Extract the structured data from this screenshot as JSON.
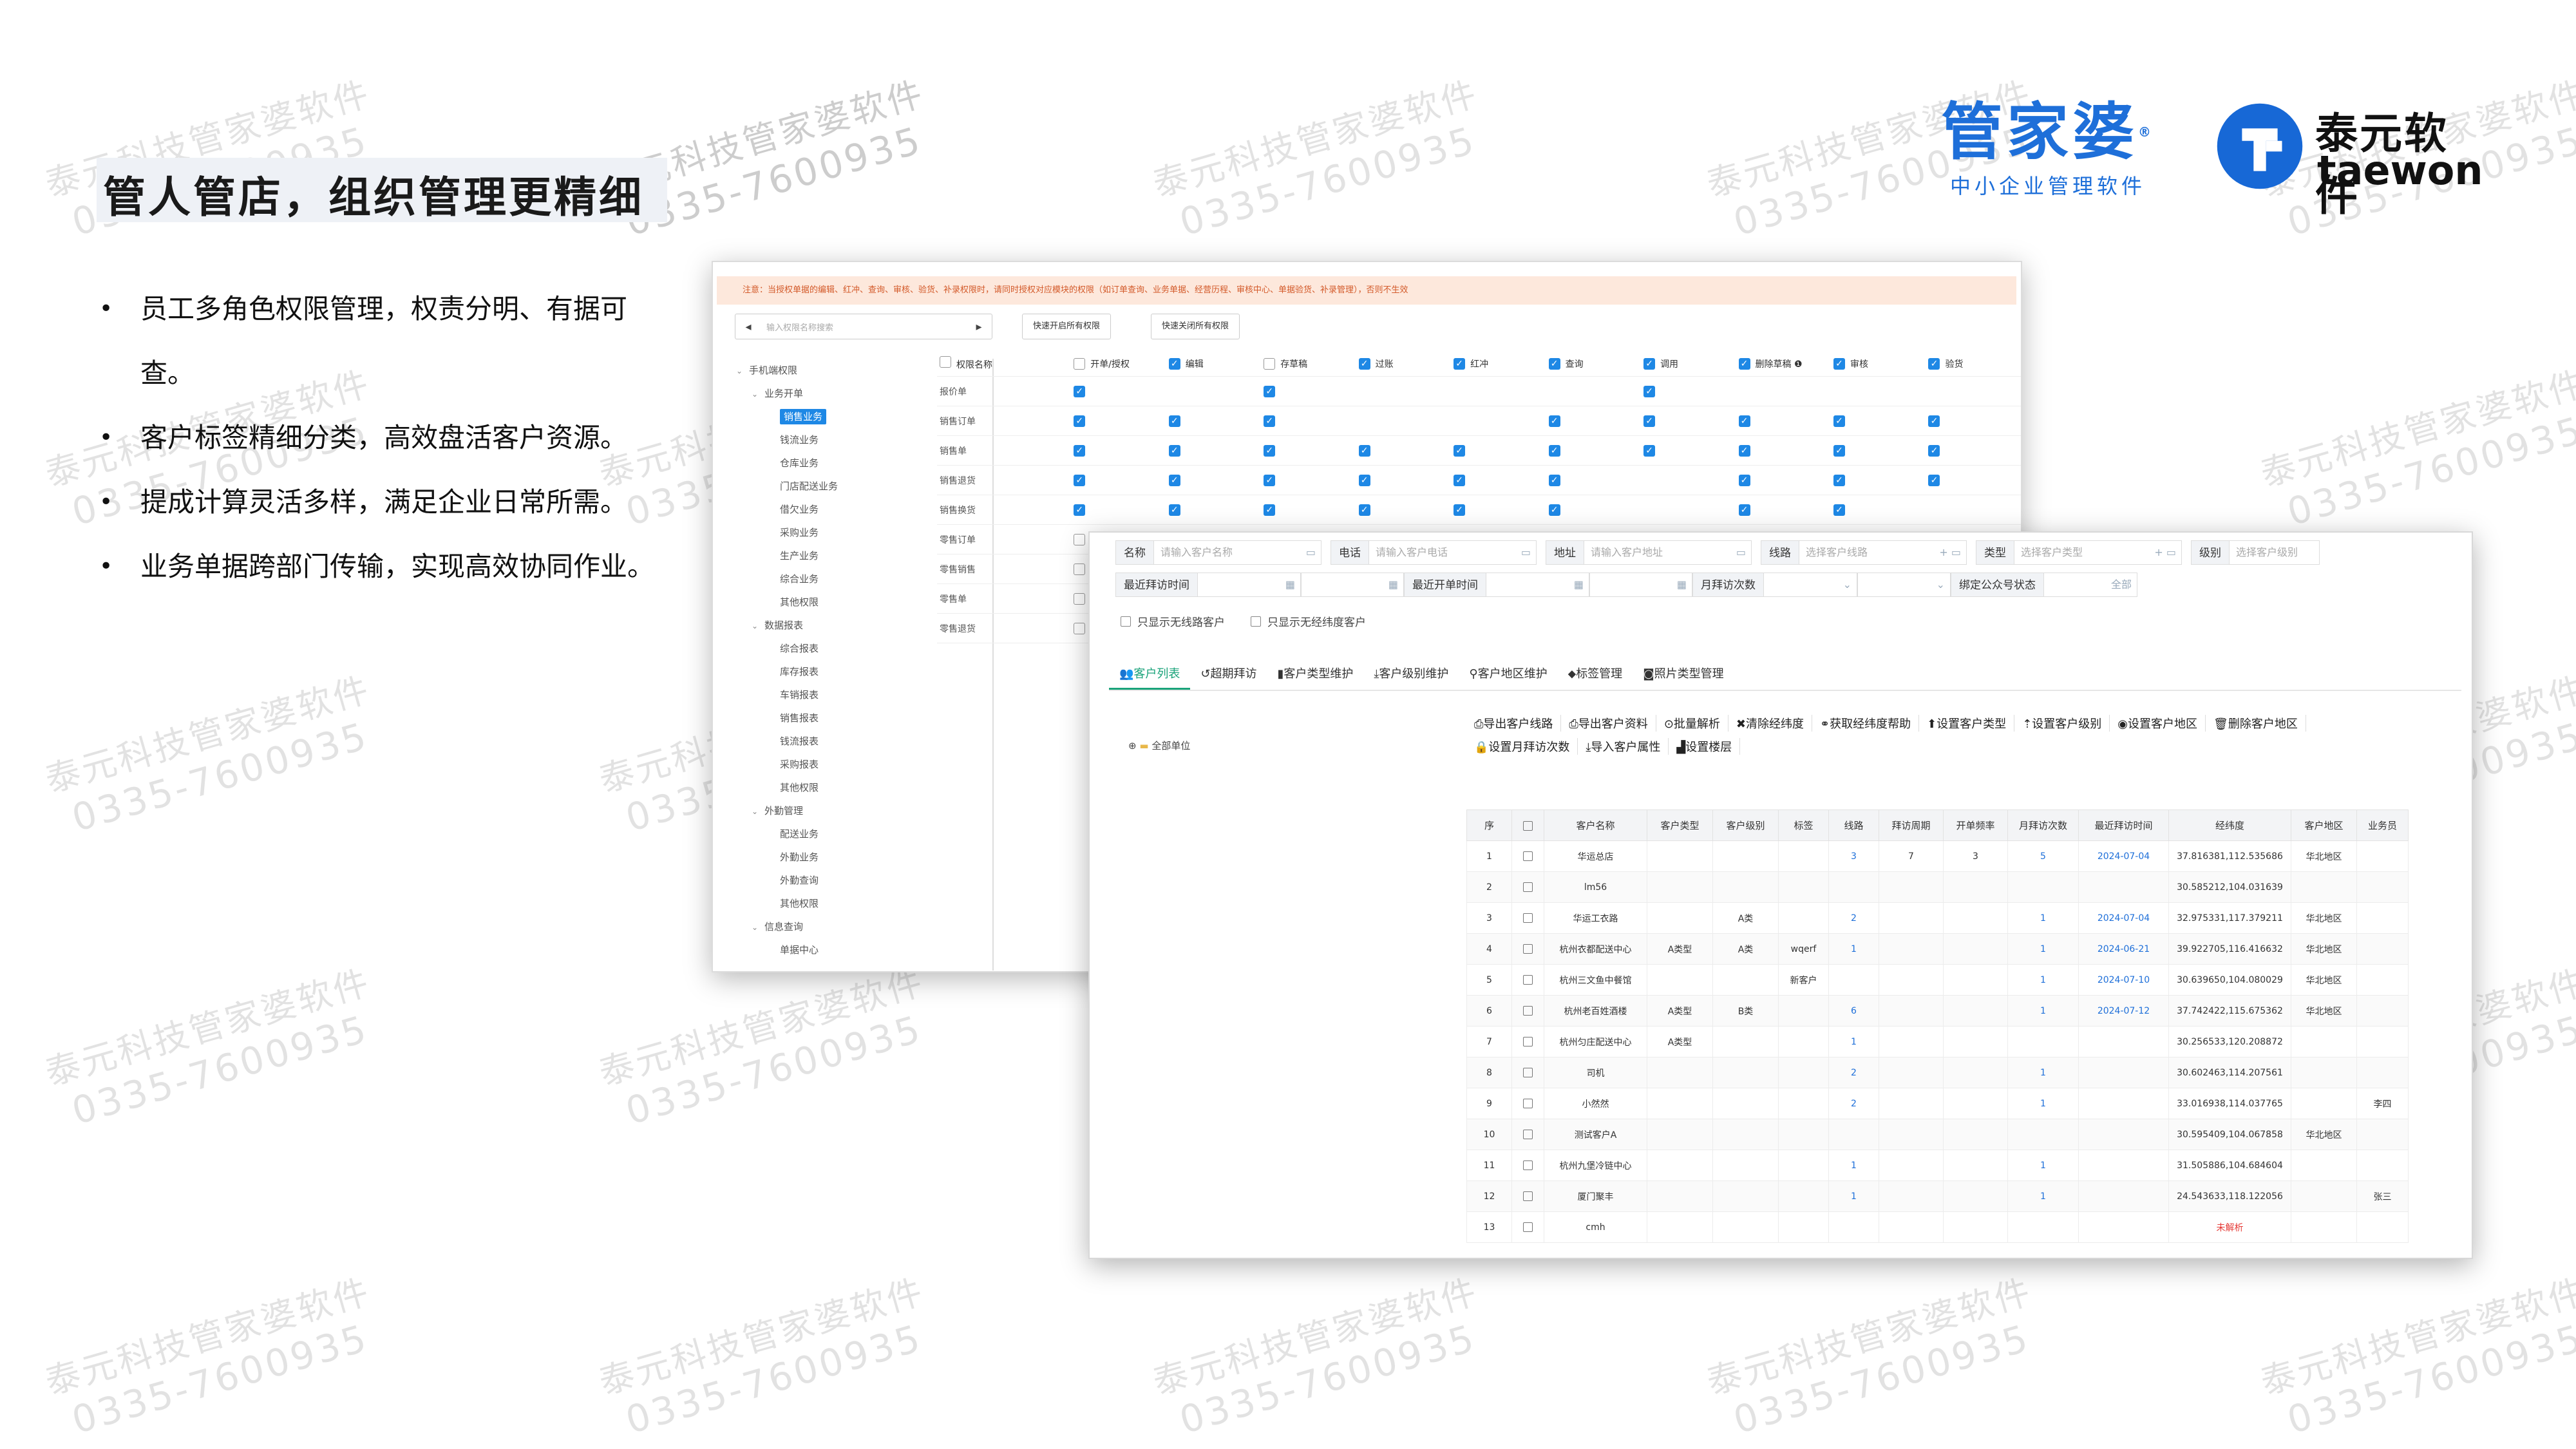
{
  "slide": {
    "title": "管人管店，组织管理更精细",
    "bullets": [
      "员工多角色权限管理，权责分明、有据可查。",
      "客户标签精细分类，高效盘活客户资源。",
      "提成计算灵活多样，满足企业日常所需。",
      "业务单据跨部门传输，实现高效协同作业。"
    ]
  },
  "brand": {
    "gjp_name": "管家婆",
    "gjp_reg": "®",
    "gjp_sub": "中小企业管理软件",
    "ty_name_cn": "泰元软件",
    "ty_name_en": "taewon",
    "colors": {
      "gjp_blue": "#1e6fd9",
      "ty_blue": "#1768d6"
    }
  },
  "watermark": {
    "line1": "泰元科技管家婆软件",
    "line2": "0335-7600935"
  },
  "permissions": {
    "note": "注意：当授权单据的编辑、红冲、查询、审核、验货、补录权限时，请同时授权对应模块的权限（如订单查询、业务单据、经营历程、审核中心、单据验货、补录管理），否则不生效",
    "search_placeholder": "输入权限名称搜索",
    "nav_prev": "◂",
    "nav_next": "▸",
    "btn_open_all": "快速开启所有权限",
    "btn_close_all": "快速关闭所有权限",
    "tree": [
      {
        "label": "手机端权限",
        "level": 0,
        "arrow": "⌄"
      },
      {
        "label": "业务开单",
        "level": 1,
        "arrow": "⌄"
      },
      {
        "label": "销售业务",
        "level": 2,
        "selected": true
      },
      {
        "label": "钱流业务",
        "level": 2
      },
      {
        "label": "仓库业务",
        "level": 2
      },
      {
        "label": "门店配送业务",
        "level": 2
      },
      {
        "label": "借欠业务",
        "level": 2
      },
      {
        "label": "采购业务",
        "level": 2
      },
      {
        "label": "生产业务",
        "level": 2
      },
      {
        "label": "综合业务",
        "level": 2
      },
      {
        "label": "其他权限",
        "level": 2
      },
      {
        "label": "数据报表",
        "level": 1,
        "arrow": "⌄"
      },
      {
        "label": "综合报表",
        "level": 2
      },
      {
        "label": "库存报表",
        "level": 2
      },
      {
        "label": "车销报表",
        "level": 2
      },
      {
        "label": "销售报表",
        "level": 2
      },
      {
        "label": "钱流报表",
        "level": 2
      },
      {
        "label": "采购报表",
        "level": 2
      },
      {
        "label": "其他权限",
        "level": 2
      },
      {
        "label": "外勤管理",
        "level": 1,
        "arrow": "⌄"
      },
      {
        "label": "配送业务",
        "level": 2
      },
      {
        "label": "外勤业务",
        "level": 2
      },
      {
        "label": "外勤查询",
        "level": 2
      },
      {
        "label": "其他权限",
        "level": 2
      },
      {
        "label": "信息查询",
        "level": 1,
        "arrow": "⌄"
      },
      {
        "label": "单据中心",
        "level": 2
      }
    ],
    "columns": [
      "开单/授权",
      "编辑",
      "存草稿",
      "过账",
      "红冲",
      "查询",
      "调用",
      "删除草稿 ❶",
      "审核",
      "验货"
    ],
    "column_header_checked": [
      false,
      true,
      false,
      true,
      true,
      true,
      true,
      true,
      true,
      true
    ],
    "name_header": "权限名称",
    "rows": [
      {
        "name": "报价单",
        "checks": [
          1,
          0,
          1,
          0,
          0,
          0,
          1,
          0,
          0,
          0
        ]
      },
      {
        "name": "销售订单",
        "checks": [
          1,
          1,
          1,
          0,
          0,
          1,
          1,
          1,
          1,
          1
        ]
      },
      {
        "name": "销售单",
        "checks": [
          1,
          1,
          1,
          1,
          1,
          1,
          1,
          1,
          1,
          1
        ]
      },
      {
        "name": "销售退货",
        "checks": [
          1,
          1,
          1,
          1,
          1,
          1,
          0,
          1,
          1,
          1
        ]
      },
      {
        "name": "销售换货",
        "checks": [
          1,
          1,
          1,
          1,
          1,
          1,
          0,
          1,
          1,
          0
        ]
      },
      {
        "name": "零售订单",
        "checks": [
          0,
          0,
          0,
          0,
          0,
          0,
          0,
          0,
          0,
          0
        ]
      },
      {
        "name": "零售销售",
        "checks": [
          0,
          0,
          0,
          0,
          0,
          0,
          0,
          0,
          0,
          0
        ]
      },
      {
        "name": "零售单",
        "checks": [
          0,
          0,
          0,
          0,
          0,
          0,
          0,
          0,
          0,
          0
        ]
      },
      {
        "name": "零售退货",
        "checks": [
          0,
          0,
          0,
          0,
          0,
          0,
          0,
          0,
          0,
          0
        ]
      }
    ]
  },
  "customers": {
    "filters_row1": [
      {
        "label": "名称",
        "placeholder": "请输入客户名称",
        "icon": "▭"
      },
      {
        "label": "电话",
        "placeholder": "请输入客户电话",
        "icon": "▭"
      },
      {
        "label": "地址",
        "placeholder": "请输入客户地址",
        "icon": "▭"
      },
      {
        "label": "线路",
        "placeholder": "选择客户线路",
        "icon": "+  ▭"
      },
      {
        "label": "类型",
        "placeholder": "选择客户类型",
        "icon": "+  ▭"
      },
      {
        "label": "级别",
        "placeholder": "选择客户级别",
        "icon": ""
      }
    ],
    "filters_row2": [
      {
        "label": "最近拜访时间",
        "icon": "▦"
      },
      {
        "label": "",
        "icon": "▦"
      },
      {
        "label": "最近开单时间",
        "icon": "▦"
      },
      {
        "label": "",
        "icon": "▦"
      },
      {
        "label": "月拜访次数",
        "icon": "⌄"
      },
      {
        "label": "",
        "icon": "⌄"
      },
      {
        "label": "绑定公众号状态",
        "icon": "全部"
      }
    ],
    "check_no_route": "只显示无线路客户",
    "check_no_geo": "只显示无经纬度客户",
    "tabs": [
      {
        "label": "客户列表",
        "icon": "👥",
        "active": true
      },
      {
        "label": "超期拜访",
        "icon": "↺"
      },
      {
        "label": "客户类型维护",
        "icon": "▮"
      },
      {
        "label": "客户级别维护",
        "icon": "⤓"
      },
      {
        "label": "客户地区维护",
        "icon": "⚲"
      },
      {
        "label": "标签管理",
        "icon": "⬥"
      },
      {
        "label": "照片类型管理",
        "icon": "◙"
      }
    ],
    "tree_root": "全部单位",
    "toolbar_row1": [
      {
        "label": "导出客户线路",
        "icon": "⎙"
      },
      {
        "label": "导出客户资料",
        "icon": "⎙"
      },
      {
        "label": "批量解析",
        "icon": "⊙"
      },
      {
        "label": "清除经纬度",
        "icon": "✖"
      },
      {
        "label": "获取经纬度帮助",
        "icon": "⚭"
      },
      {
        "label": "设置客户类型",
        "icon": "⬆"
      },
      {
        "label": "设置客户级别",
        "icon": "⇡"
      },
      {
        "label": "设置客户地区",
        "icon": "◉"
      },
      {
        "label": "删除客户地区",
        "icon": "🗑"
      }
    ],
    "toolbar_row2": [
      {
        "label": "设置月拜访次数",
        "icon": "🔒"
      },
      {
        "label": "导入客户属性",
        "icon": "⤓"
      },
      {
        "label": "设置楼层",
        "icon": "▟"
      }
    ],
    "columns": [
      "序",
      "",
      "客户名称",
      "客户类型",
      "客户级别",
      "标签",
      "线路",
      "拜访周期",
      "开单频率",
      "月拜访次数",
      "最近拜访时间",
      "经纬度",
      "客户地区",
      "业务员"
    ],
    "rows": [
      [
        "1",
        "",
        "华运总店",
        "",
        "",
        "",
        "3",
        "7",
        "3",
        "5",
        "2024-07-04",
        "37.816381,112.535686",
        "华北地区",
        ""
      ],
      [
        "2",
        "",
        "lm56",
        "",
        "",
        "",
        "",
        "",
        "",
        "",
        "",
        "30.585212,104.031639",
        "",
        ""
      ],
      [
        "3",
        "",
        "华运工衣路",
        "",
        "A类",
        "",
        "2",
        "",
        "",
        "1",
        "2024-07-04",
        "32.975331,117.379211",
        "华北地区",
        ""
      ],
      [
        "4",
        "",
        "杭州衣都配送中心",
        "A类型",
        "A类",
        "wqerf",
        "1",
        "",
        "",
        "1",
        "2024-06-21",
        "39.922705,116.416632",
        "华北地区",
        ""
      ],
      [
        "5",
        "",
        "杭州三文鱼中餐馆",
        "",
        "",
        "新客户",
        "",
        "",
        "",
        "1",
        "2024-07-10",
        "30.639650,104.080029",
        "华北地区",
        ""
      ],
      [
        "6",
        "",
        "杭州老百姓酒楼",
        "A类型",
        "B类",
        "",
        "6",
        "",
        "",
        "1",
        "2024-07-12",
        "37.742422,115.675362",
        "华北地区",
        ""
      ],
      [
        "7",
        "",
        "杭州匀庄配送中心",
        "A类型",
        "",
        "",
        "1",
        "",
        "",
        "",
        "",
        "30.256533,120.208872",
        "",
        ""
      ],
      [
        "8",
        "",
        "司机",
        "",
        "",
        "",
        "2",
        "",
        "",
        "1",
        "",
        "30.602463,114.207561",
        "",
        ""
      ],
      [
        "9",
        "",
        "小然然",
        "",
        "",
        "",
        "2",
        "",
        "",
        "1",
        "",
        "33.016938,114.037765",
        "",
        "李四"
      ],
      [
        "10",
        "",
        "测试客户A",
        "",
        "",
        "",
        "",
        "",
        "",
        "",
        "",
        "30.595409,104.067858",
        "华北地区",
        ""
      ],
      [
        "11",
        "",
        "杭州九堡冷链中心",
        "",
        "",
        "",
        "1",
        "",
        "",
        "1",
        "",
        "31.505886,104.684604",
        "",
        ""
      ],
      [
        "12",
        "",
        "厦门聚丰",
        "",
        "",
        "",
        "1",
        "",
        "",
        "1",
        "",
        "24.543633,118.122056",
        "",
        "张三"
      ],
      [
        "13",
        "",
        "cmh",
        "",
        "",
        "",
        "",
        "",
        "",
        "",
        "",
        "未解析",
        "",
        ""
      ]
    ]
  }
}
